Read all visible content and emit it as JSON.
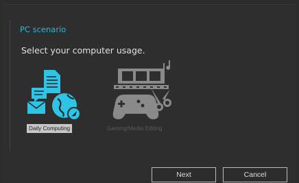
{
  "dialog": {
    "title": "PC scenario",
    "prompt": "Select your computer usage."
  },
  "options": [
    {
      "label": "Daily Computing",
      "icon": "daily-computing-icon",
      "selected": true
    },
    {
      "label": "Gaming/Media Editing",
      "icon": "gaming-media-icon",
      "selected": false
    }
  ],
  "buttons": {
    "next_label": "Next",
    "cancel_label": "Cancel"
  },
  "colors": {
    "accent": "#2fb8d8",
    "background": "#2c2c2c",
    "selected_label_bg": "#c8c8c8",
    "disabled_icon": "#8a8a8a"
  }
}
